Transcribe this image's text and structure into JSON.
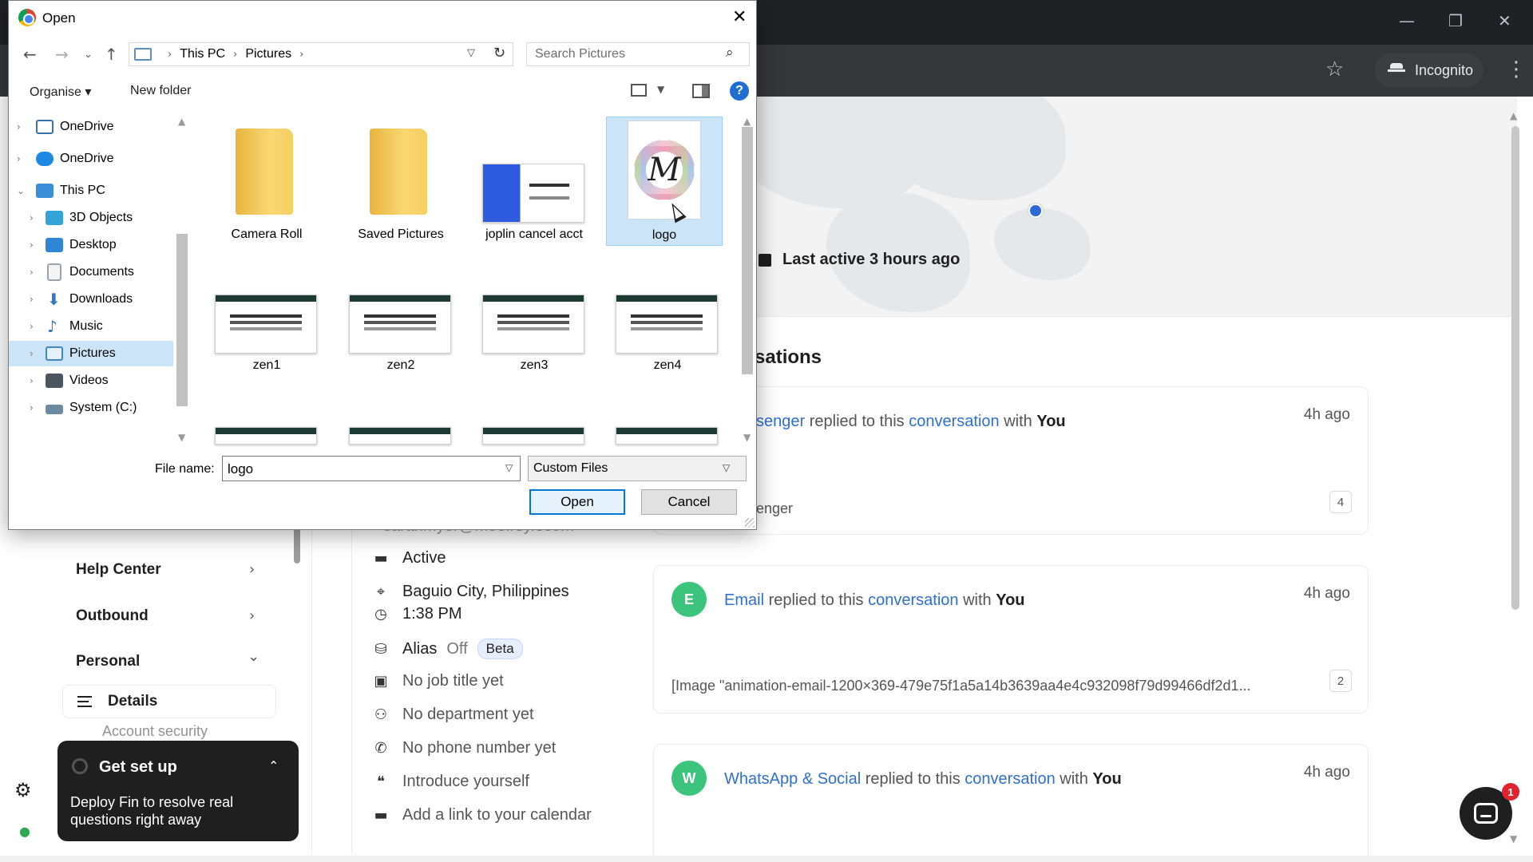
{
  "browser": {
    "incognito_label": "Incognito",
    "minimize": "—",
    "restore": "❐",
    "close": "✕"
  },
  "profile": {
    "last_active": "Last active 3 hours ago",
    "email_partial": "sarahmyer@moolrey.ecom"
  },
  "sidebar": {
    "items": [
      {
        "label": "Help Center",
        "chevron": "›"
      },
      {
        "label": "Outbound",
        "chevron": "›"
      },
      {
        "label": "Personal",
        "chevron": "⌄"
      }
    ],
    "details_label": "Details",
    "partial_label": "Account security",
    "get_set_up": {
      "title": "Get set up",
      "body": "Deploy Fin to resolve real questions right away"
    }
  },
  "details": {
    "status": "Active",
    "location": "Baguio City, Philippines",
    "time": "1:38 PM",
    "alias_label": "Alias",
    "alias_value": "Off",
    "alias_badge": "Beta",
    "job_title": "No job title yet",
    "department": "No department yet",
    "phone": "No phone number yet",
    "introduce": "Introduce yourself",
    "calendar": "Add a link to your calendar"
  },
  "conversations": {
    "title": "sations",
    "items": [
      {
        "avatar": "",
        "source": "senger",
        "verb": "replied to this",
        "link": "conversation",
        "with": "with",
        "who": "You",
        "time": "4h ago",
        "preview": "enger",
        "count": "4"
      },
      {
        "avatar": "E",
        "source": "Email",
        "verb": "replied to this",
        "link": "conversation",
        "with": "with",
        "who": "You",
        "time": "4h ago",
        "preview": "[Image \"animation-email-1200×369-479e75f1a5a14b3639aa4e4c932098f79d99466df2d1...",
        "count": "2"
      },
      {
        "avatar": "W",
        "source": "WhatsApp & Social",
        "verb": "replied to this",
        "link": "conversation",
        "with": "with",
        "who": "You",
        "time": "4h ago"
      }
    ]
  },
  "messenger": {
    "badge": "1"
  },
  "dialog": {
    "title": "Open",
    "path": [
      "This PC",
      "Pictures"
    ],
    "search_placeholder": "Search Pictures",
    "toolbar": {
      "organise": "Organise ▾",
      "new_folder": "New folder",
      "help": "?"
    },
    "tree": [
      {
        "label": "OneDrive",
        "expander": "›",
        "icon": "onedrive-icon",
        "color": "#3a6fb0"
      },
      {
        "label": "OneDrive",
        "expander": "›",
        "icon": "cloud-icon",
        "color": "#1e88e5"
      },
      {
        "label": "This PC",
        "expander": "⌄",
        "icon": "pc-icon",
        "color": "#3b8fd9"
      },
      {
        "label": "3D Objects",
        "expander": "›",
        "icon": "cube-icon",
        "color": "#33a3d8"
      },
      {
        "label": "Desktop",
        "expander": "›",
        "icon": "desktop-icon",
        "color": "#2f86d6"
      },
      {
        "label": "Documents",
        "expander": "›",
        "icon": "documents-icon",
        "color": "#9aa4ad"
      },
      {
        "label": "Downloads",
        "expander": "›",
        "icon": "downloads-icon",
        "color": "#2e78c7"
      },
      {
        "label": "Music",
        "expander": "›",
        "icon": "music-icon",
        "color": "#2e78c7"
      },
      {
        "label": "Pictures",
        "expander": "›",
        "icon": "pictures-icon",
        "color": "#3f88c5"
      },
      {
        "label": "Videos",
        "expander": "›",
        "icon": "videos-icon",
        "color": "#4a5560"
      },
      {
        "label": "System (C:)",
        "expander": "›",
        "icon": "drive-icon",
        "color": "#6d8aa0"
      }
    ],
    "files": [
      {
        "name": "Camera Roll",
        "kind": "folder"
      },
      {
        "name": "Saved Pictures",
        "kind": "folder"
      },
      {
        "name": "joplin cancel acct",
        "kind": "image"
      },
      {
        "name": "logo",
        "kind": "image",
        "selected": true
      },
      {
        "name": "zen1",
        "kind": "image"
      },
      {
        "name": "zen2",
        "kind": "image"
      },
      {
        "name": "zen3",
        "kind": "image"
      },
      {
        "name": "zen4",
        "kind": "image"
      }
    ],
    "file_name_label": "File name:",
    "file_name_value": "logo",
    "file_type": "Custom Files",
    "open_button": "Open",
    "cancel_button": "Cancel"
  }
}
